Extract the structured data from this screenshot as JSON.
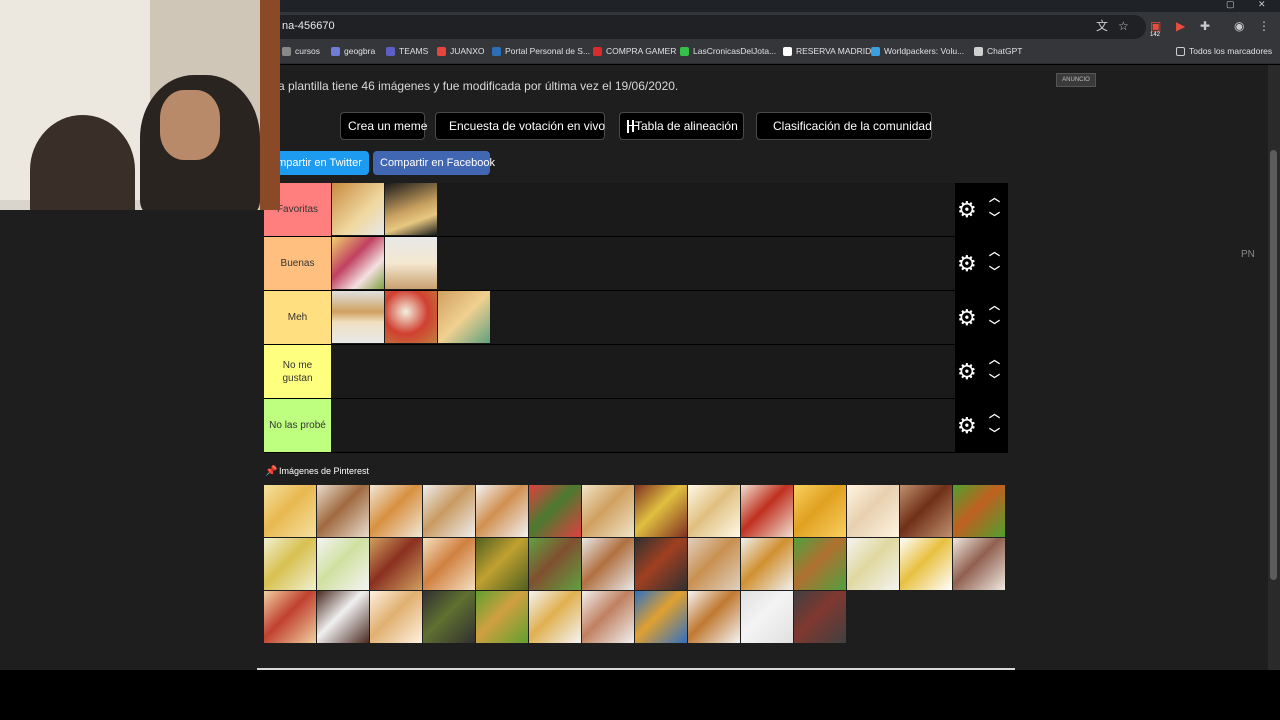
{
  "browser": {
    "url": "na-456670",
    "extension_badge": "142",
    "bookmarks": [
      {
        "label": "cursos",
        "color": "#888888"
      },
      {
        "label": "geogbra",
        "color": "#6f7bd6"
      },
      {
        "label": "TEAMS",
        "color": "#5b5fc7"
      },
      {
        "label": "JUANXO",
        "color": "#e8453c"
      },
      {
        "label": "Portal Personal de S...",
        "color": "#2a6fb8"
      },
      {
        "label": "COMPRA GAMER",
        "color": "#d92b2b"
      },
      {
        "label": "LasCronicasDelJota...",
        "color": "#35c04a"
      },
      {
        "label": "RESERVA MADRID",
        "color": "#ffffff"
      },
      {
        "label": "Worldpackers: Volu...",
        "color": "#3aa0e0"
      },
      {
        "label": "ChatGPT",
        "color": "#d0d0d0"
      }
    ],
    "all_bookmarks": "Todos los marcadores"
  },
  "page": {
    "info_text": "a plantilla tiene 46 imágenes y fue modificada por última vez el 19/06/2020.",
    "ad_label": "ANUNCIO",
    "side_text": "PN",
    "actions": [
      {
        "label": "Crea un meme"
      },
      {
        "label": "Encuesta de votación en vivo"
      },
      {
        "label": "Tabla de alineación"
      },
      {
        "label": "Clasificación de la comunidad"
      }
    ],
    "share": {
      "twitter": "ompartir en Twitter",
      "facebook": "Compartir en Facebook"
    }
  },
  "tiers": [
    {
      "label": "Favoritas",
      "color": "#ff7f7f",
      "items": [
        "empanadas",
        "milanesa-sandwich"
      ]
    },
    {
      "label": "Buenas",
      "color": "#ffbf7f",
      "items": [
        "sandwiches-de-miga",
        "cheesecake"
      ]
    },
    {
      "label": "Meh",
      "color": "#ffdf7f",
      "items": [
        "sandwich",
        "pizza",
        "medialunas"
      ]
    },
    {
      "label": "No me gustan",
      "color": "#ffff7f",
      "items": []
    },
    {
      "label": "No las probé",
      "color": "#bfff7f",
      "items": []
    }
  ],
  "pool": {
    "title": "Imágenes de Pinterest",
    "items": [
      {
        "name": "chipa",
        "c1": "#e8b850",
        "c2": "#f5e0a0"
      },
      {
        "name": "bunuelos",
        "c1": "#a06a40",
        "c2": "#e8dccc"
      },
      {
        "name": "canelones",
        "c1": "#d89040",
        "c2": "#f0e8d8"
      },
      {
        "name": "alfajores",
        "c1": "#c89a60",
        "c2": "#eeeeee"
      },
      {
        "name": "tostadas",
        "c1": "#d09050",
        "c2": "#f2f2f2"
      },
      {
        "name": "sushi",
        "c1": "#4a7a30",
        "c2": "#e04040"
      },
      {
        "name": "panqueques",
        "c1": "#d0a060",
        "c2": "#f0e4c8"
      },
      {
        "name": "flan-dulce",
        "c1": "#e0c040",
        "c2": "#803020"
      },
      {
        "name": "budin",
        "c1": "#e0c080",
        "c2": "#fff8e8"
      },
      {
        "name": "guiso",
        "c1": "#c03020",
        "c2": "#f0e0d0"
      },
      {
        "name": "papas-fritas",
        "c1": "#e0a020",
        "c2": "#f8d060"
      },
      {
        "name": "huevos",
        "c1": "#e8d0b0",
        "c2": "#fff4e0"
      },
      {
        "name": "lentejas",
        "c1": "#703018",
        "c2": "#c09070"
      },
      {
        "name": "hamburguesa",
        "c1": "#c06020",
        "c2": "#50a030"
      },
      {
        "name": "humita",
        "c1": "#d8c050",
        "c2": "#f0f0d0"
      },
      {
        "name": "helado",
        "c1": "#d0e0a0",
        "c2": "#f4f4f4"
      },
      {
        "name": "lasagna",
        "c1": "#8a3020",
        "c2": "#d0a060"
      },
      {
        "name": "rosquitas",
        "c1": "#d08040",
        "c2": "#f4e0c0"
      },
      {
        "name": "tarta",
        "c1": "#c0a030",
        "c2": "#506020"
      },
      {
        "name": "choripan",
        "c1": "#805030",
        "c2": "#60a040"
      },
      {
        "name": "pollo",
        "c1": "#b07040",
        "c2": "#e8e8e8"
      },
      {
        "name": "albondigas",
        "c1": "#a04020",
        "c2": "#303030"
      },
      {
        "name": "empanadas-fritas",
        "c1": "#c89050",
        "c2": "#e0d0c0"
      },
      {
        "name": "flan",
        "c1": "#d09030",
        "c2": "#f0f0f0"
      },
      {
        "name": "milanesa",
        "c1": "#b07030",
        "c2": "#50a040"
      },
      {
        "name": "noquis",
        "c1": "#e0d8a0",
        "c2": "#f4f4f0"
      },
      {
        "name": "tortilla",
        "c1": "#e8c040",
        "c2": "#ffffff"
      },
      {
        "name": "carne",
        "c1": "#906050",
        "c2": "#f0e8e0"
      },
      {
        "name": "pancho",
        "c1": "#c04030",
        "c2": "#f0d0a0"
      },
      {
        "name": "crema",
        "c1": "#f0f0f0",
        "c2": "#4a2a20"
      },
      {
        "name": "pizza-casera",
        "c1": "#e0b070",
        "c2": "#fff0e0"
      },
      {
        "name": "verduras",
        "c1": "#607030",
        "c2": "#303030"
      },
      {
        "name": "tacos",
        "c1": "#d0a040",
        "c2": "#60a030"
      },
      {
        "name": "sopa",
        "c1": "#e0b050",
        "c2": "#f4f4f4"
      },
      {
        "name": "torta",
        "c1": "#c08060",
        "c2": "#f0f0f0"
      },
      {
        "name": "fideos",
        "c1": "#e0a030",
        "c2": "#3070c0"
      },
      {
        "name": "waffles",
        "c1": "#c07830",
        "c2": "#f4f4f4"
      },
      {
        "name": "pure",
        "c1": "#f4f4f4",
        "c2": "#e0e0e0"
      },
      {
        "name": "asado",
        "c1": "#803830",
        "c2": "#404040"
      }
    ]
  }
}
